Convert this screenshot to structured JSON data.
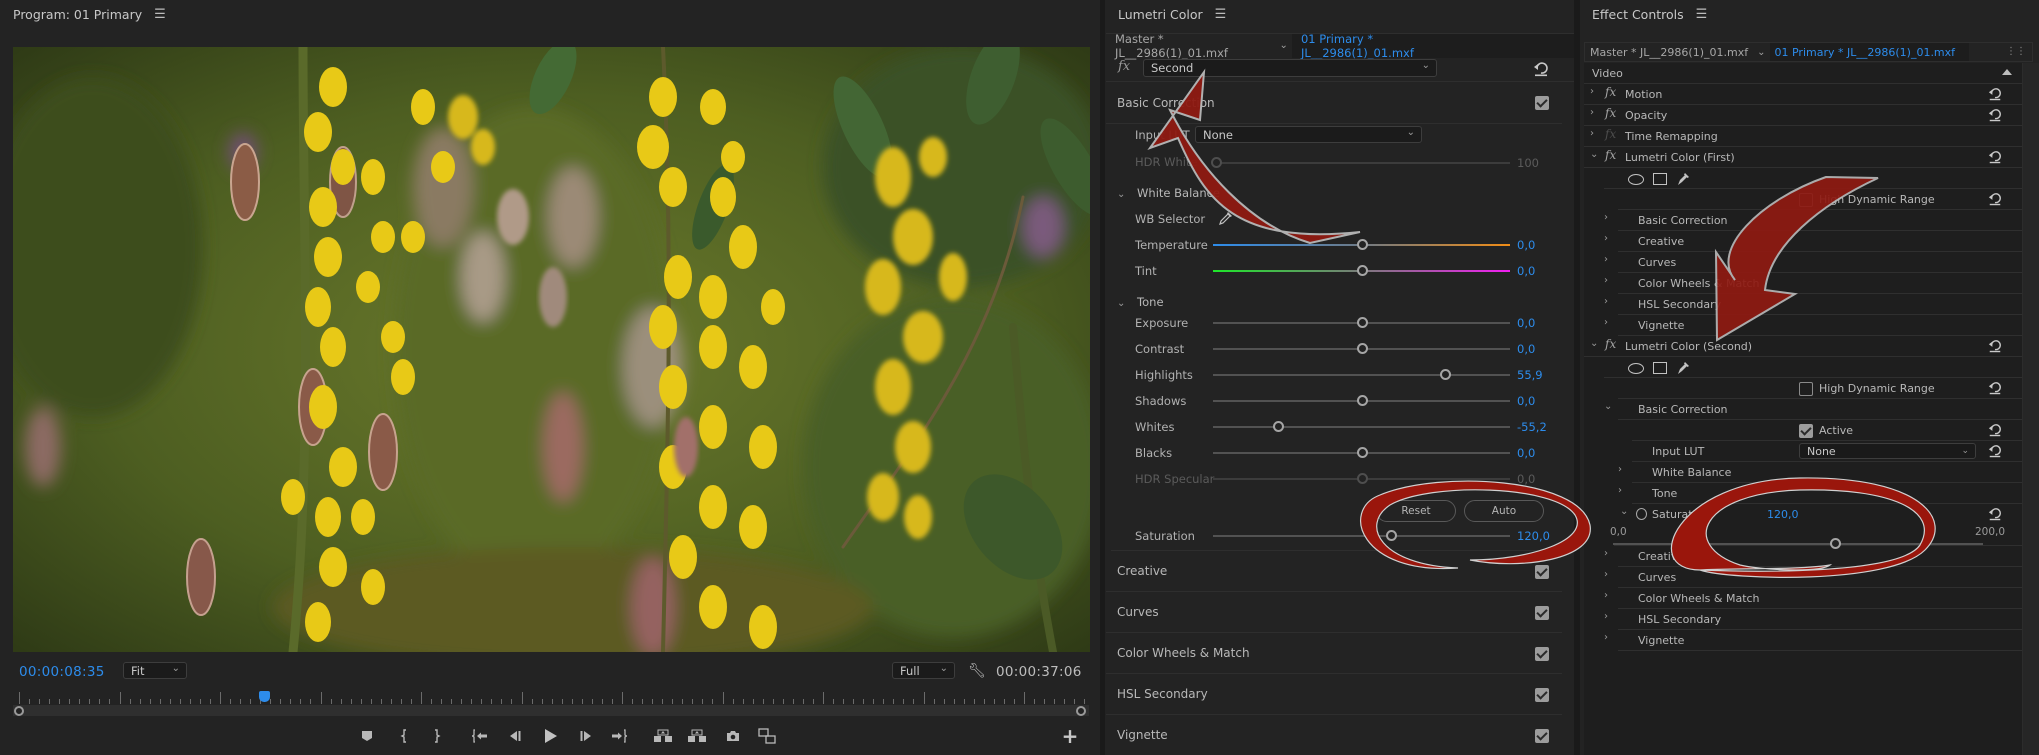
{
  "program_monitor": {
    "title": "Program: 01 Primary",
    "current_timecode": "00:00:08:35",
    "duration_timecode": "00:00:37:06",
    "zoom_select": "Fit",
    "quality_select": "Full",
    "playhead_fraction": 0.23,
    "transport": [
      {
        "name": "add-marker",
        "icon": "marker-icon"
      },
      {
        "name": "mark-in",
        "icon": "mark-in-icon"
      },
      {
        "name": "mark-out",
        "icon": "mark-out-icon"
      },
      {
        "name": "go-to-in",
        "icon": "go-to-in-icon"
      },
      {
        "name": "step-back",
        "icon": "step-back-icon"
      },
      {
        "name": "play",
        "icon": "play-icon"
      },
      {
        "name": "step-forward",
        "icon": "step-forward-icon"
      },
      {
        "name": "go-to-out",
        "icon": "go-to-out-icon"
      },
      {
        "name": "lift",
        "icon": "lift-icon"
      },
      {
        "name": "extract",
        "icon": "extract-icon"
      },
      {
        "name": "export-frame",
        "icon": "camera-icon"
      },
      {
        "name": "comparison-view",
        "icon": "comparison-view-icon"
      }
    ],
    "add_button": "+"
  },
  "lumetri": {
    "title": "Lumetri Color",
    "master_tab": "Master * JL__2986(1)_01.mxf",
    "active_tab": "01 Primary * JL__2986(1)_01.mxf",
    "fx_label": "fx",
    "instance_select": "Second",
    "sections": {
      "basic_correction": {
        "label": "Basic Correction",
        "enabled": true,
        "input_lut_label": "Input LUT",
        "input_lut_value": "None",
        "hdr_white_label": "HDR White",
        "hdr_white_value": "100",
        "white_balance": {
          "label": "White Balance",
          "wb_selector_label": "WB Selector",
          "temperature_label": "Temperature",
          "temperature_value": "0,0",
          "tint_label": "Tint",
          "tint_value": "0,0"
        },
        "tone": {
          "label": "Tone",
          "sliders": [
            {
              "label": "Exposure",
              "value": "0,0",
              "position": 0.5
            },
            {
              "label": "Contrast",
              "value": "0,0",
              "position": 0.5
            },
            {
              "label": "Highlights",
              "value": "55,9",
              "position": 0.78
            },
            {
              "label": "Shadows",
              "value": "0,0",
              "position": 0.5
            },
            {
              "label": "Whites",
              "value": "-55,2",
              "position": 0.22
            },
            {
              "label": "Blacks",
              "value": "0,0",
              "position": 0.5
            },
            {
              "label": "HDR Specular",
              "value": "0,0",
              "position": 0.5,
              "disabled": true
            }
          ]
        },
        "reset_label": "Reset",
        "auto_label": "Auto",
        "saturation_label": "Saturation",
        "saturation_value": "120,0",
        "saturation_position": 0.6
      },
      "collapsed": [
        {
          "label": "Creative",
          "enabled": true
        },
        {
          "label": "Curves",
          "enabled": true
        },
        {
          "label": "Color Wheels & Match",
          "enabled": true
        },
        {
          "label": "HSL Secondary",
          "enabled": true
        },
        {
          "label": "Vignette",
          "enabled": true
        }
      ]
    }
  },
  "effect_controls": {
    "title": "Effect Controls",
    "master_tab": "Master * JL__2986(1)_01.mxf",
    "active_tab": "01 Primary * JL__2986(1)_01.mxf",
    "video_header": "Video",
    "fixed_effects": [
      {
        "label": "Motion",
        "fx_enabled": true
      },
      {
        "label": "Opacity",
        "fx_enabled": true
      },
      {
        "label": "Time Remapping",
        "fx_enabled": false
      }
    ],
    "lumetri_first": {
      "label": "Lumetri Color (First)",
      "hdr_label": "High Dynamic Range",
      "hdr_checked": false,
      "sections": [
        "Basic Correction",
        "Creative",
        "Curves",
        "Color Wheels & Match",
        "HSL Secondary",
        "Vignette"
      ]
    },
    "lumetri_second": {
      "label": "Lumetri Color (Second)",
      "hdr_label": "High Dynamic Range",
      "hdr_checked": false,
      "basic_correction_label": "Basic Correction",
      "active_label": "Active",
      "active_checked": true,
      "input_lut_label": "Input LUT",
      "input_lut_value": "None",
      "white_balance_label": "White Balance",
      "tone_label": "Tone",
      "saturation_label": "Saturation",
      "saturation_value": "120,0",
      "saturation_min": "0,0",
      "saturation_max": "200,0",
      "saturation_fraction": 0.6,
      "sections": [
        "Creative",
        "Curves",
        "Color Wheels & Match",
        "HSL Secondary",
        "Vignette"
      ]
    }
  },
  "colors": {
    "accent_blue": "#2d8ceb",
    "annotation_red": "#8f1a12",
    "panel_bg": "#232323"
  }
}
